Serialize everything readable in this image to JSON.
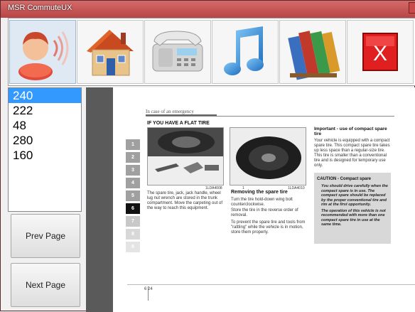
{
  "window": {
    "title": "MSR CommuteUX"
  },
  "toolbar": {
    "buttons": [
      {
        "icon": "user-speaking-icon"
      },
      {
        "icon": "house-icon"
      },
      {
        "icon": "telephone-icon"
      },
      {
        "icon": "music-note-icon"
      },
      {
        "icon": "books-icon"
      },
      {
        "icon": "close-x-icon"
      }
    ]
  },
  "page_list": {
    "items": [
      "240",
      "222",
      "48",
      "280",
      "160"
    ],
    "selected": "240"
  },
  "nav": {
    "prev_label": "Prev Page",
    "next_label": "Next Page"
  },
  "document": {
    "header": "In case of an emergency",
    "section_title": "IF YOU HAVE A FLAT TIRE",
    "tabs": [
      "1",
      "2",
      "3",
      "4",
      "5",
      "6",
      "7",
      "8",
      "9"
    ],
    "current_tab": "6",
    "photo1_caption": "1LDA4008",
    "photo2_caption": "1LDA4010",
    "photo2_num": "1",
    "para1": "The spare tire, jack, jack handle, wheel lug nut wrench are stored in the trunk compartment. Move the carpeting out of the way to reach this equipment.",
    "removing_title": "Removing the spare tire",
    "removing_p1": "Turn the tire hold-down wing bolt counterclockwise.",
    "removing_p2": "Store the tire in the reverse order of removal.",
    "removing_p3": "To prevent the spare tire and tools from \"rattling\" while the vehicle is in motion, store them properly.",
    "important_title": "Important - use of compact spare tire",
    "important_text": "Your vehicle is equipped with a compact spare tire. This compact spare tire takes up less space than a regular-size tire. This tire is smaller than a conventional tire and is designed for temporary use only.",
    "caution_title": "CAUTION - Compact spare",
    "caution_b1": "You should drive carefully when the compact spare is in use. The compact spare should be replaced by the proper conventional tire and rim at the first opportunity.",
    "caution_b2": "The operation of this vehicle is not recommended with more than one compact spare tire in use at the same time.",
    "footer": "6 24"
  }
}
